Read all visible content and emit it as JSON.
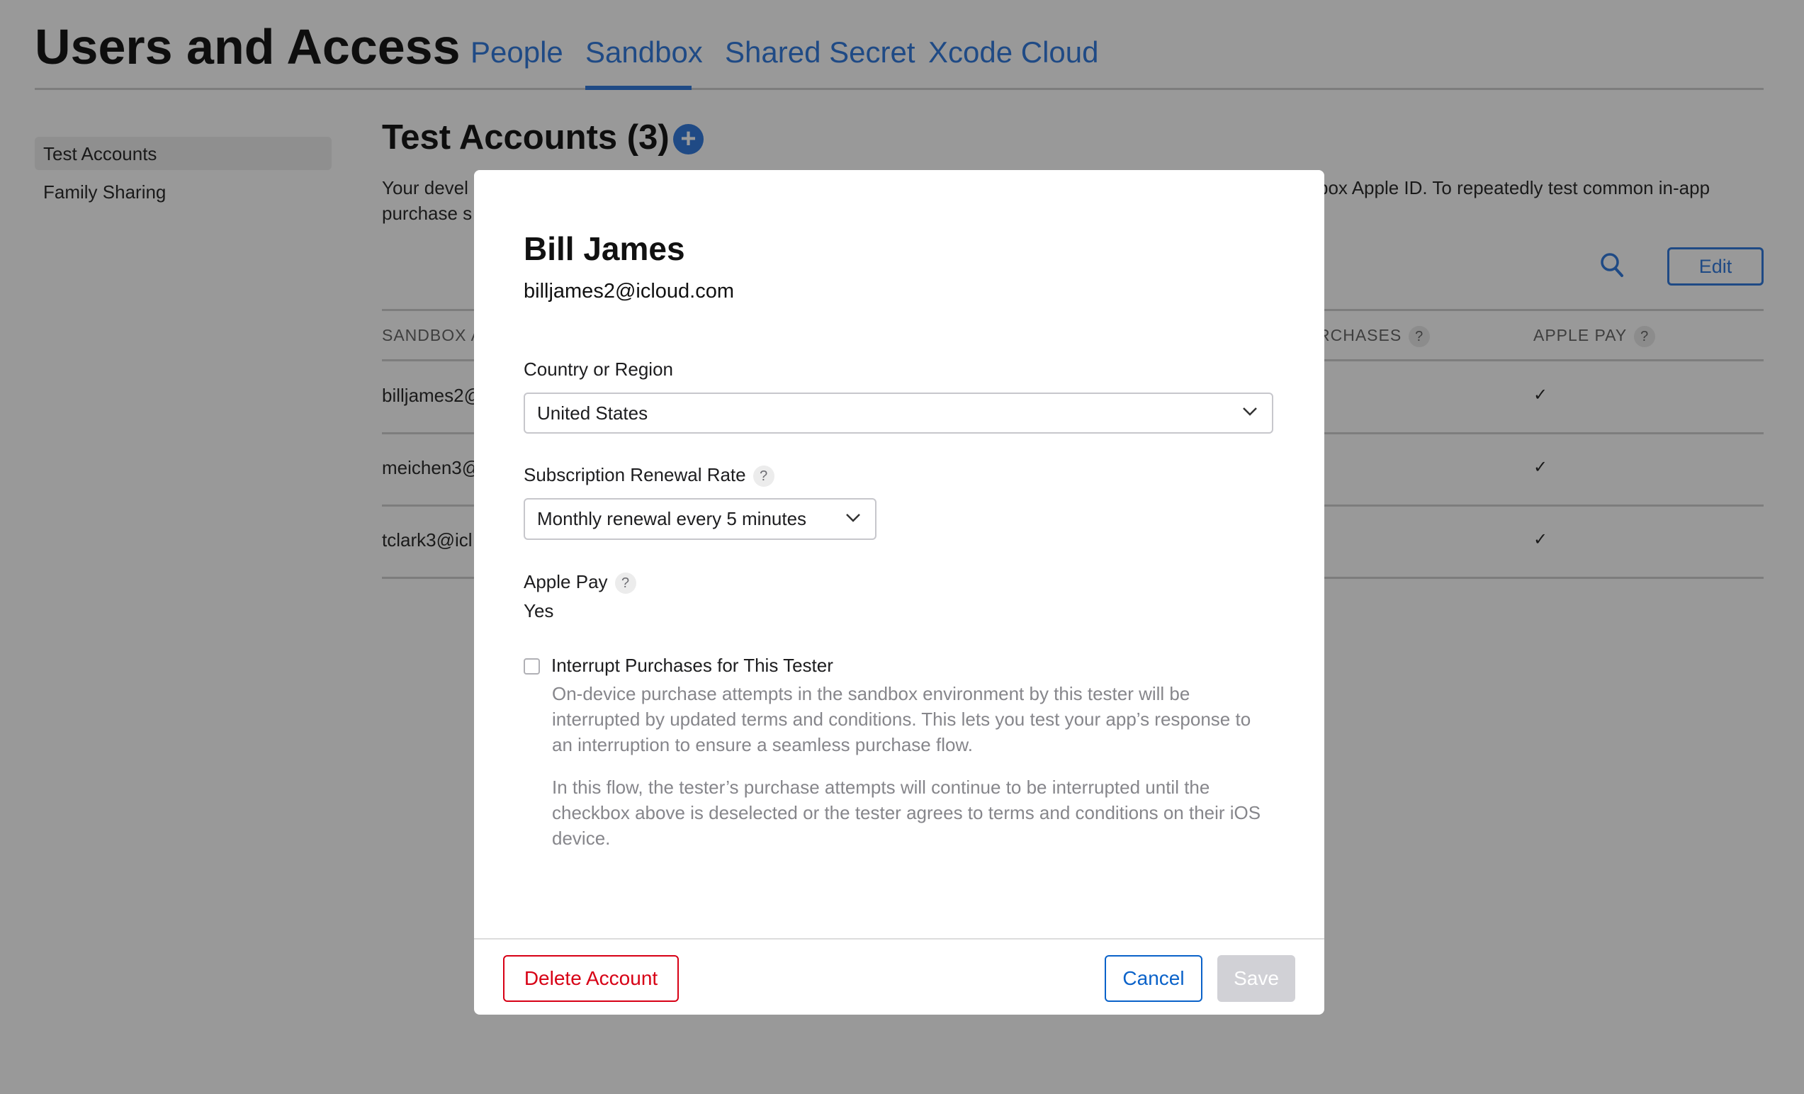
{
  "header": {
    "title": "Users and Access",
    "tabs": [
      {
        "label": "People"
      },
      {
        "label": "Sandbox",
        "active": true
      },
      {
        "label": "Shared Secret"
      },
      {
        "label": "Xcode Cloud"
      }
    ]
  },
  "sidebar": {
    "items": [
      {
        "label": "Test Accounts",
        "selected": true
      },
      {
        "label": "Family Sharing"
      }
    ]
  },
  "main": {
    "title": "Test Accounts (3)",
    "description_fragments": [
      "Your devel",
      "box Apple ID. To repeatedly test common in-app",
      "purchase s"
    ],
    "edit_label": "Edit",
    "table": {
      "headers": [
        "SANDBOX A",
        "RCHASES",
        "APPLE PAY"
      ],
      "rows": [
        {
          "account": "billjames2@",
          "apple_pay": "✓"
        },
        {
          "account": "meichen3@",
          "apple_pay": "✓"
        },
        {
          "account": "tclark3@icl",
          "apple_pay": "✓"
        }
      ]
    }
  },
  "modal": {
    "name": "Bill James",
    "email": "billjames2@icloud.com",
    "country_label": "Country or Region",
    "country_value": "United States",
    "renewal_label": "Subscription Renewal Rate",
    "renewal_value": "Monthly renewal every 5 minutes",
    "apple_pay_label": "Apple Pay",
    "apple_pay_value": "Yes",
    "interrupt_label": "Interrupt Purchases for This Tester",
    "interrupt_checked": false,
    "interrupt_desc_1": "On-device purchase attempts in the sandbox environment by this tester will be interrupted by updated terms and conditions. This lets you test your app’s response to an interruption to ensure a seamless purchase flow.",
    "interrupt_desc_2": "In this flow, the tester’s purchase attempts will continue to be interrupted until the checkbox above is deselected or the tester agrees to terms and conditions on their iOS device.",
    "help": "?",
    "delete_label": "Delete Account",
    "cancel_label": "Cancel",
    "save_label": "Save"
  },
  "colors": {
    "accent": "#0a62c9",
    "danger": "#d70015",
    "overlay": "#999999"
  }
}
